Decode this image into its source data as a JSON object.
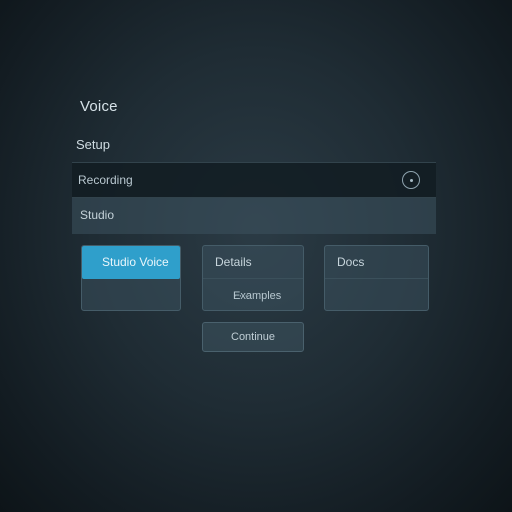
{
  "header": {
    "title": "Voice"
  },
  "section": {
    "label": "Setup"
  },
  "rows": {
    "first": {
      "label": "Recording",
      "icon": "circle-info-icon"
    },
    "second": {
      "label": "Studio"
    }
  },
  "options": [
    {
      "label": "Studio Voice",
      "selected": true,
      "sub": ""
    },
    {
      "label": "Details",
      "selected": false,
      "sub": "Examples"
    },
    {
      "label": "Docs",
      "selected": false,
      "sub": ""
    }
  ],
  "bottom_button": {
    "label": "Continue"
  },
  "colors": {
    "accent": "#2f9fcb",
    "background": "#1f2c34"
  }
}
